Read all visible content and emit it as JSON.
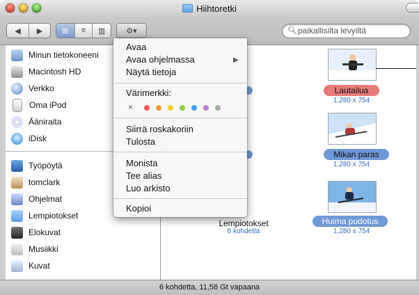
{
  "window": {
    "title": "Hiihtoretki"
  },
  "toolbar": {
    "back_glyph": "◀",
    "forward_glyph": "▶",
    "view_icon_glyph": "⊞",
    "view_list_glyph": "≡",
    "view_column_glyph": "▥",
    "action_glyph": "⚙▾"
  },
  "search": {
    "placeholder": "paikallisilta levyiltä"
  },
  "sidebar": {
    "devices": [
      {
        "label": "Minun tietokoneeni",
        "icon": "computer-icon"
      },
      {
        "label": "Macintosh HD",
        "icon": "hard-disk-icon"
      },
      {
        "label": "Verkko",
        "icon": "network-globe-icon"
      },
      {
        "label": "Oma iPod",
        "icon": "ipod-icon"
      },
      {
        "label": "Ääniraita",
        "icon": "cd-icon"
      },
      {
        "label": "iDisk",
        "icon": "idisk-icon"
      }
    ],
    "places": [
      {
        "label": "Työpöytä",
        "icon": "desktop-icon"
      },
      {
        "label": "tomclark",
        "icon": "home-icon"
      },
      {
        "label": "Ohjelmat",
        "icon": "applications-icon"
      },
      {
        "label": "Lempiotokset",
        "icon": "folder-icon"
      },
      {
        "label": "Elokuvat",
        "icon": "movies-icon"
      },
      {
        "label": "Musiikki",
        "icon": "music-icon"
      },
      {
        "label": "Kuvat",
        "icon": "pictures-icon"
      }
    ]
  },
  "content": {
    "folder_item": {
      "name": "Lempiotokset",
      "meta": "8 kohdetta"
    },
    "files": [
      {
        "name": "Lautailua",
        "meta": "1,280 x 754",
        "label_color": "#e87a7a"
      },
      {
        "name": "Mikan paras",
        "meta": "1,280 x 754",
        "label_color": "#6f98d6"
      },
      {
        "name": "Huima pudotus",
        "meta": "1,280 x 754",
        "label_color": "#6f98d6"
      }
    ]
  },
  "menu": {
    "items": {
      "open": "Avaa",
      "open_with": "Avaa ohjelmassa",
      "open_with_arrow": "▶",
      "show_info": "Näytä tietoja",
      "color_label": "Värimerkki:",
      "none_glyph": "×",
      "move_to_trash": "Siirrä roskakoriin",
      "print": "Tulosta",
      "duplicate": "Monista",
      "make_alias": "Tee alias",
      "create_archive": "Luo arkisto",
      "copy": "Kopioi"
    },
    "label_colors": [
      "#f05a5a",
      "#f79a35",
      "#f3cf2e",
      "#8ccd3d",
      "#3a9ee8",
      "#c27cd8",
      "#a9a9a9"
    ]
  },
  "status": {
    "text": "6 kohdetta, 11,58 Gt vapaana"
  }
}
